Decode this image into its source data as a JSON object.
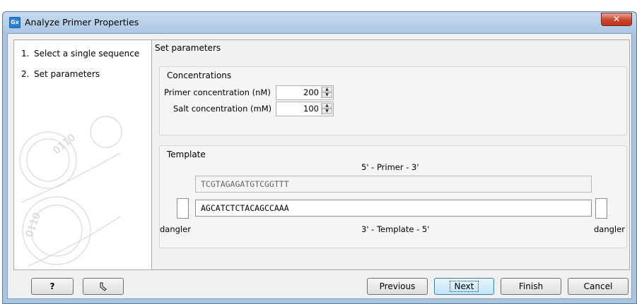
{
  "window": {
    "title": "Analyze Primer Properties",
    "app_icon": "Gx",
    "close_glyph": "✕",
    "accent_color": "#2a7fd4"
  },
  "steps": [
    {
      "num": "1.",
      "label": "Select a single sequence"
    },
    {
      "num": "2.",
      "label": "Set parameters"
    }
  ],
  "panel": {
    "title": "Set parameters",
    "concentrations": {
      "group_label": "Concentrations",
      "primer_label": "Primer concentration (nM)",
      "primer_value": "200",
      "salt_label": "Salt concentration (mM)",
      "salt_value": "100"
    },
    "template": {
      "group_label": "Template",
      "primer_header": "5' - Primer - 3'",
      "primer_sequence": "TCGTAGAGATGTCGGTTT",
      "template_sequence": "AGCATCTCTACAGCCAAA",
      "template_footer": "3' - Template - 5'",
      "dangler_left": "dangler",
      "dangler_right": "dangler"
    }
  },
  "buttons": {
    "help": "?",
    "previous": "Previous",
    "next": "Next",
    "finish": "Finish",
    "cancel": "Cancel"
  }
}
